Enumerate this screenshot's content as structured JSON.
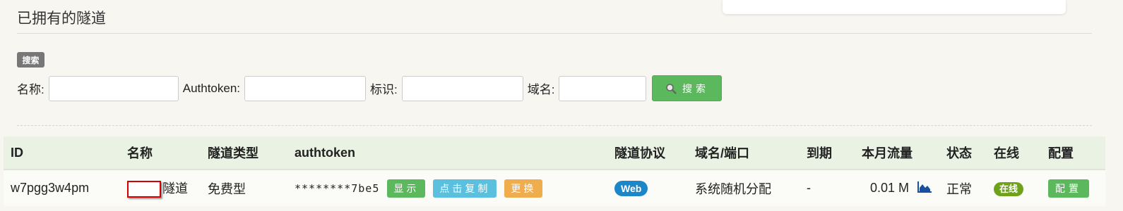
{
  "section": {
    "title": "已拥有的隧道"
  },
  "search": {
    "badge": "搜索",
    "name_label": "名称:",
    "authtoken_label": "Authtoken:",
    "tag_label": "标识:",
    "domain_label": "域名:",
    "button_label": "搜索"
  },
  "table": {
    "headers": [
      "ID",
      "名称",
      "隧道类型",
      "authtoken",
      "隧道协议",
      "域名/端口",
      "到期",
      "本月流量",
      "状态",
      "在线",
      "配置"
    ],
    "rows": [
      {
        "id": "w7pgg3w4pm",
        "name_suffix": "隧道",
        "type": "免费型",
        "authtoken": "********7be5",
        "show_label": "显示",
        "copy_label": "点击复制",
        "change_label": "更换",
        "protocol": "Web",
        "domain_port": "系统随机分配",
        "expiry": "-",
        "traffic": "0.01 M",
        "status": "正常",
        "online": "在线",
        "config_label": "配置"
      }
    ]
  },
  "colors": {
    "green": "#5cb85c",
    "blue": "#5bc0de",
    "orange": "#f0ad4e",
    "protocol": "#1d86c8",
    "online": "#6ea21a"
  }
}
